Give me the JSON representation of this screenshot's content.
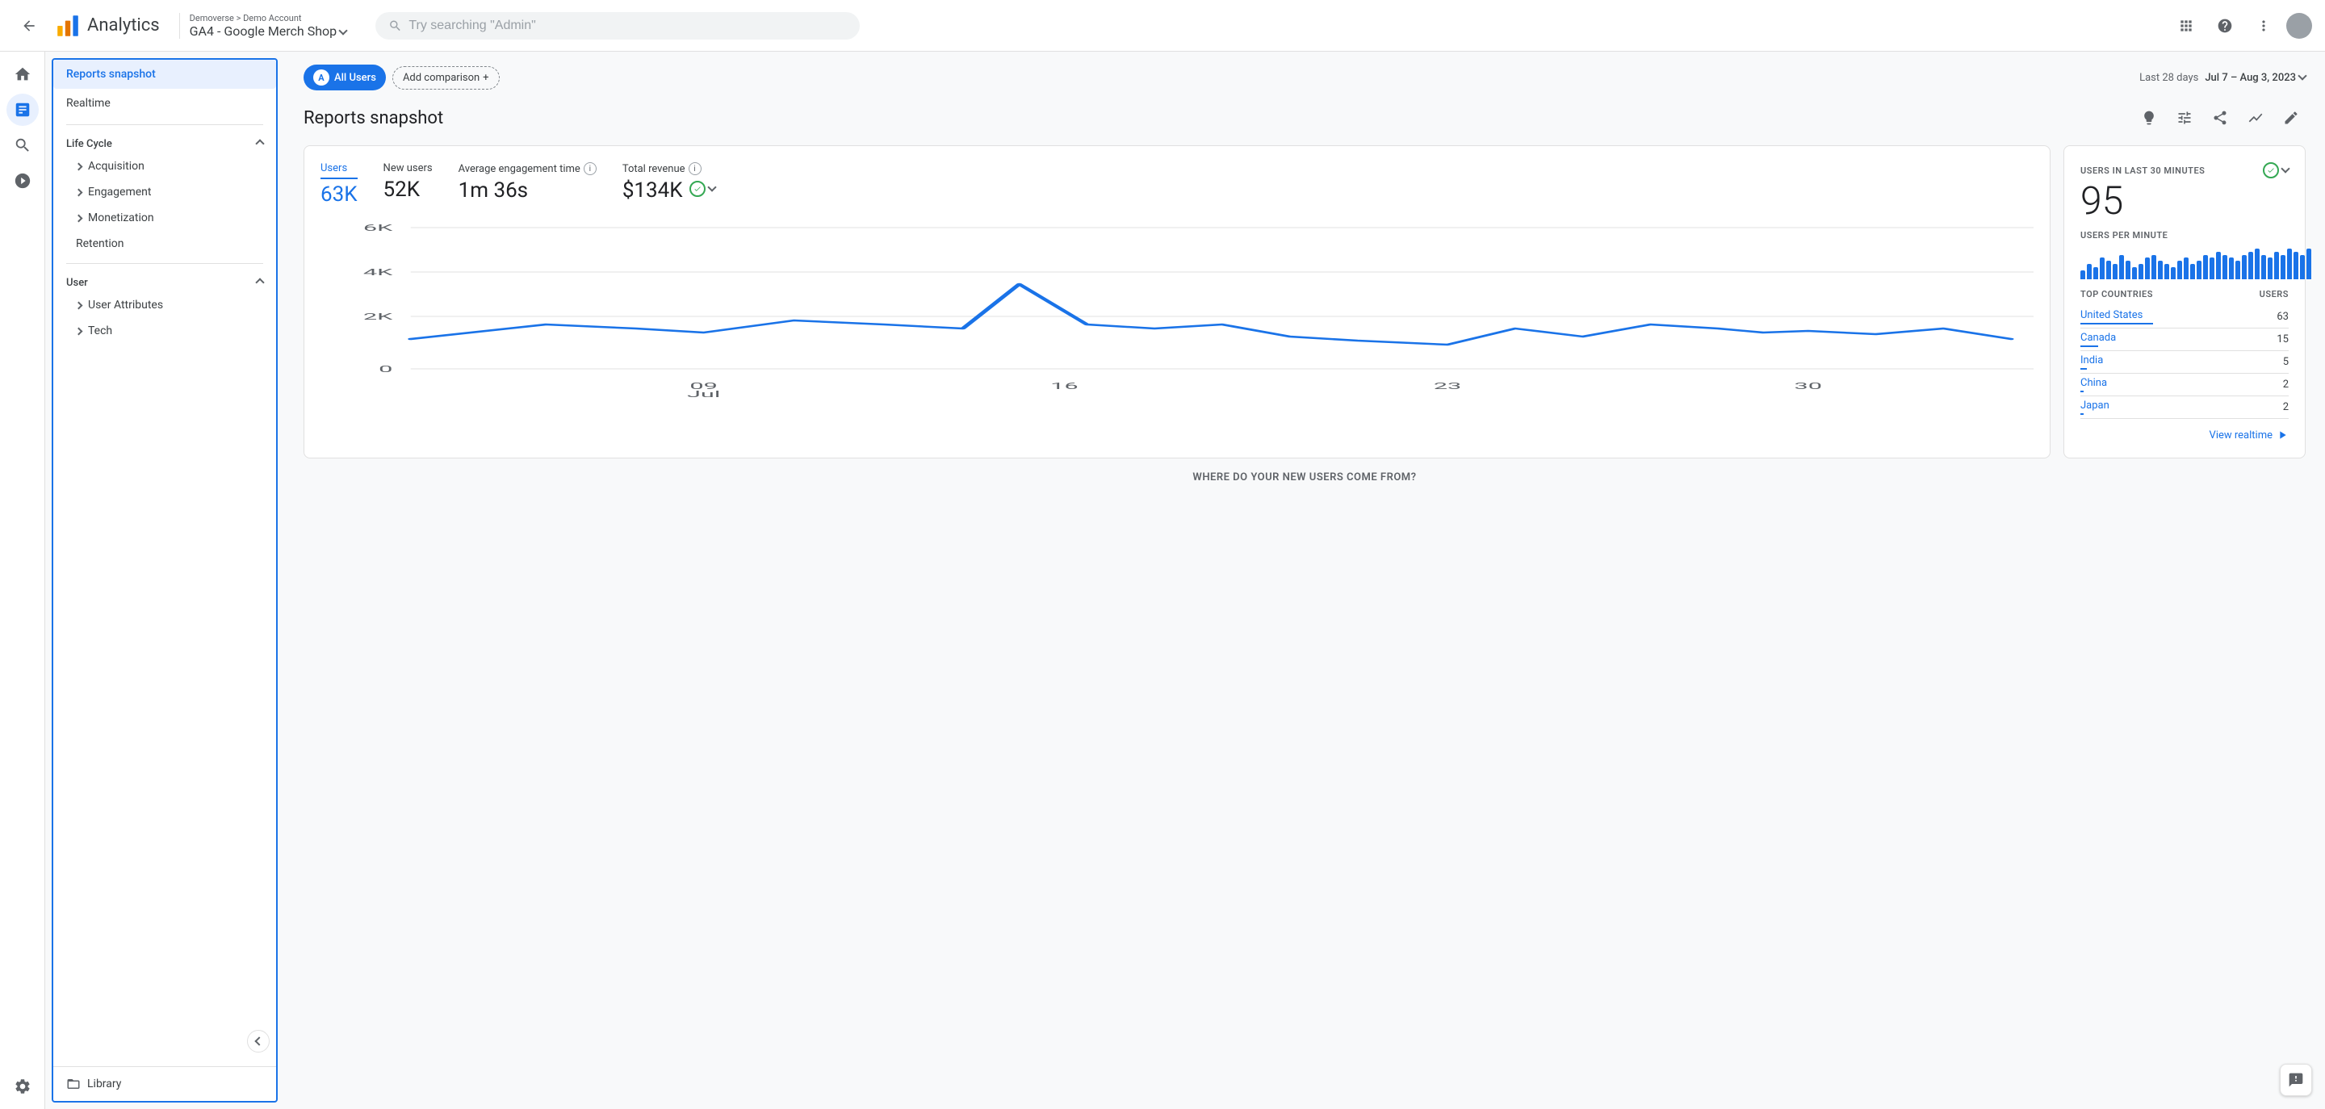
{
  "header": {
    "back_label": "←",
    "app_title": "Analytics",
    "breadcrumb_top": "Demoverse > Demo Account",
    "account_name": "GA4 - Google Merch Shop",
    "search_placeholder": "Try searching \"Admin\"",
    "apps_icon": "apps-icon",
    "help_icon": "help-icon",
    "more_icon": "more-icon"
  },
  "sidebar": {
    "reports_snapshot": "Reports snapshot",
    "realtime": "Realtime",
    "lifecycle_label": "Life Cycle",
    "acquisition": "Acquisition",
    "engagement": "Engagement",
    "monetization": "Monetization",
    "retention": "Retention",
    "user_label": "User",
    "user_attributes": "User Attributes",
    "tech": "Tech",
    "library": "Library"
  },
  "topbar": {
    "all_users": "All Users",
    "all_users_initial": "A",
    "add_comparison": "Add comparison",
    "last_n_days": "Last 28 days",
    "date_range": "Jul 7 – Aug 3, 2023"
  },
  "report": {
    "title": "Reports snapshot",
    "metrics": [
      {
        "label": "Users",
        "value": "63K",
        "active": true
      },
      {
        "label": "New users",
        "value": "52K",
        "active": false
      },
      {
        "label": "Average engagement time",
        "value": "1m 36s",
        "active": false,
        "has_info": true
      },
      {
        "label": "Total revenue",
        "value": "$134K",
        "active": false,
        "has_info": true
      }
    ],
    "chart_y_labels": [
      "6K",
      "4K",
      "2K",
      "0"
    ],
    "chart_x_labels": [
      "09 Jul",
      "16",
      "23",
      "30"
    ]
  },
  "realtime": {
    "label": "USERS IN LAST 30 MINUTES",
    "count": "95",
    "per_minute_label": "USERS PER MINUTE",
    "bars": [
      3,
      5,
      4,
      7,
      6,
      5,
      8,
      6,
      4,
      5,
      7,
      8,
      6,
      5,
      4,
      6,
      7,
      5,
      6,
      8,
      7,
      9,
      8,
      7,
      6,
      8,
      9,
      10,
      8,
      7,
      9,
      8,
      10,
      9,
      8,
      10
    ],
    "countries_header_left": "TOP COUNTRIES",
    "countries_header_right": "USERS",
    "countries": [
      {
        "name": "United States",
        "users": 63,
        "bar_pct": 90
      },
      {
        "name": "Canada",
        "users": 15,
        "bar_pct": 22
      },
      {
        "name": "India",
        "users": 5,
        "bar_pct": 8
      },
      {
        "name": "China",
        "users": 2,
        "bar_pct": 4
      },
      {
        "name": "Japan",
        "users": 2,
        "bar_pct": 4
      }
    ],
    "view_realtime": "View realtime"
  },
  "bottom": {
    "title": "WHERE DO YOUR NEW USERS COME FROM?"
  }
}
